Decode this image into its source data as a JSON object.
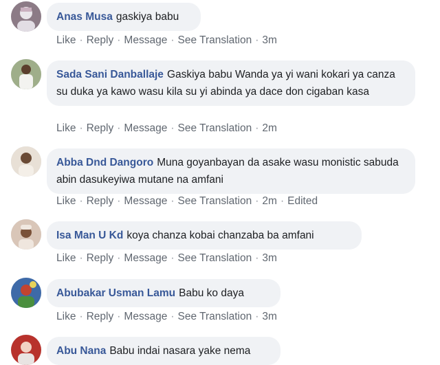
{
  "actions": {
    "like": "Like",
    "reply": "Reply",
    "message": "Message",
    "see_translation": "See Translation",
    "separator": "·"
  },
  "comments": [
    {
      "author": "Anas Musa",
      "text": "gaskiya babu",
      "time": "3m",
      "edited": ""
    },
    {
      "author": "Sada Sani Danballaje",
      "text": "Gaskiya babu Wanda ya yi wani kokari ya canza su duka ya kawo wasu kila su yi abinda ya dace don cigaban kasa",
      "time": "2m",
      "edited": ""
    },
    {
      "author": "Abba Dnd Dangoro",
      "text": "Muna goyanbayan da asake wasu monistic sabuda abin dasukeyiwa mutane na amfani",
      "time": "2m",
      "edited": "Edited"
    },
    {
      "author": "Isa Man U Kd",
      "text": "koya chanza kobai chanzaba ba amfani",
      "time": "3m",
      "edited": ""
    },
    {
      "author": "Abubakar Usman Lamu",
      "text": "Babu ko daya",
      "time": "3m",
      "edited": ""
    },
    {
      "author": "Abu Nana",
      "text": "Babu indai nasara yake nema",
      "time": "",
      "edited": ""
    }
  ]
}
